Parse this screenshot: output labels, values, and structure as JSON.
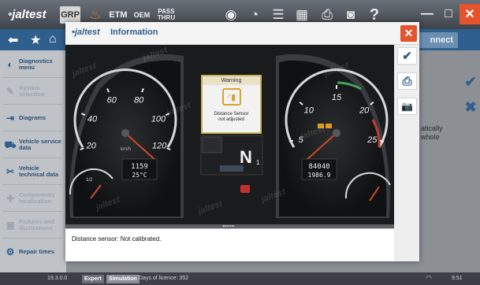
{
  "app": {
    "logo": "jaltest",
    "logo_prefix": "•",
    "toolbar": {
      "grp": "GRP",
      "etm": "ETM",
      "oem": "OEM",
      "pass": "PASS",
      "thru": "THRU"
    },
    "help_glyph": "?",
    "minimize_glyph": "—",
    "maximize_glyph": "□",
    "close_glyph": "✕",
    "connect_label": "nnect"
  },
  "sidebar": {
    "items": [
      {
        "label": "Diagnostics menu",
        "icon": "gauge-icon"
      },
      {
        "label": "System selection",
        "icon": "wrench-icon"
      },
      {
        "label": "Diagrams",
        "icon": "diagram-icon"
      },
      {
        "label": "Vehicle service data",
        "icon": "truck-icon"
      },
      {
        "label": "Vehicle technical data",
        "icon": "tools-icon"
      },
      {
        "label": "Components localisation",
        "icon": "components-icon"
      },
      {
        "label": "Pictures and illustrations",
        "icon": "pictures-icon"
      },
      {
        "label": "Repair times",
        "icon": "repair-icon"
      }
    ]
  },
  "background": {
    "text_line1": "atically",
    "text_line2": "whole"
  },
  "statusbar": {
    "version": "19.3.0.0",
    "mode": "Expert",
    "simulation": "Simulation",
    "license": "Days of licence: 352",
    "time": "9:51"
  },
  "modal": {
    "logo": "jaltest",
    "title": "Information",
    "close_glyph": "✕",
    "buttons": {
      "accept": "✔",
      "print": "⎙",
      "screenshot": "📷"
    },
    "message": "Distance sensor: Not calibrated.",
    "warning": {
      "title": "Warning",
      "line1": "Distance Sensor",
      "line2": "not adjusted"
    },
    "speedo": {
      "ticks": [
        "20",
        "40",
        "60",
        "80",
        "100",
        "120"
      ],
      "unit": "km/h",
      "odometer": "1159",
      "temperature": "25°C"
    },
    "tacho": {
      "ticks": [
        "5",
        "10",
        "15",
        "20",
        "25"
      ],
      "odometer": "84040",
      "trip": "1986.9"
    },
    "fuel_label": "1/2",
    "gear": "N",
    "gear_sub": "1",
    "watermark": "jaltest",
    "accent_color": "#e5532d",
    "brand_color": "#2f5f8c"
  }
}
